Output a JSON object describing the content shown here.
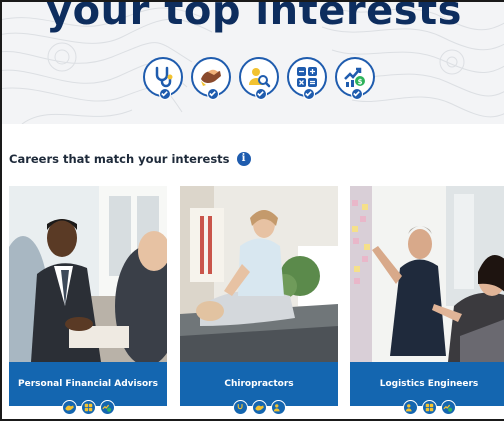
{
  "hero": {
    "title": "your top interests",
    "interest_icons": [
      "stethoscope-icon",
      "hands-icon",
      "person-search-icon",
      "calculator-icon",
      "growth-chart-icon"
    ]
  },
  "section": {
    "heading": "Careers that match your interests",
    "info_icon": "i"
  },
  "careers": [
    {
      "title": "Personal Financial Advisors",
      "badges": [
        "hands-icon",
        "calculator-icon",
        "growth-chart-icon"
      ]
    },
    {
      "title": "Chiropractors",
      "badges": [
        "stethoscope-icon",
        "hands-icon",
        "person-search-icon"
      ]
    },
    {
      "title": "Logistics Engineers",
      "badges": [
        "person-search-icon",
        "calculator-icon",
        "growth-chart-icon"
      ]
    }
  ],
  "colors": {
    "brand_navy": "#0d2d5e",
    "brand_blue": "#1f5cae",
    "card_blue": "#1466b0",
    "icon_yellow": "#f2c230",
    "icon_green": "#2fb35c",
    "icon_brown": "#8a4a2c",
    "icon_skin": "#f0b27a"
  }
}
